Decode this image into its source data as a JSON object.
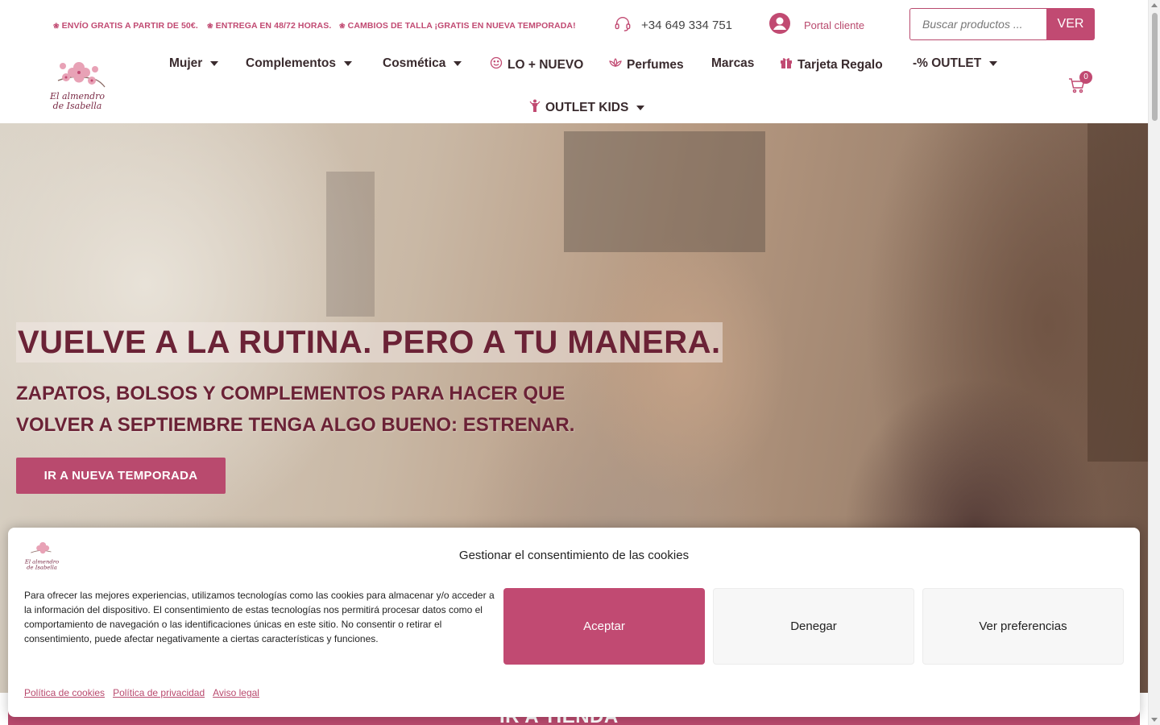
{
  "topbar": {
    "promos": [
      "ENVÍO GRATIS A PARTIR DE 50€.",
      "ENTREGA EN 48/72 HORAS.",
      "CAMBIOS DE TALLA ¡GRATIS EN NUEVA TEMPORADA!"
    ],
    "phone": "+34 649 334 751",
    "portal_label": "Portal cliente",
    "search_placeholder": "Buscar productos ...",
    "search_button": "VER"
  },
  "logo": {
    "line1": "El almendro",
    "line2": "de Isabella"
  },
  "nav": {
    "items": [
      {
        "label": "Mujer",
        "icon": "",
        "dropdown": true
      },
      {
        "label": "Complementos",
        "icon": "",
        "dropdown": true
      },
      {
        "label": "Cosmética",
        "icon": "",
        "dropdown": true
      },
      {
        "label": "LO + NUEVO",
        "icon": "smile-icon",
        "dropdown": false
      },
      {
        "label": "Perfumes",
        "icon": "lotus-icon",
        "dropdown": false
      },
      {
        "label": "Marcas",
        "icon": "",
        "dropdown": false
      },
      {
        "label": "Tarjeta Regalo",
        "icon": "gift-icon",
        "dropdown": false
      },
      {
        "label": "-% OUTLET",
        "icon": "",
        "dropdown": true
      },
      {
        "label": "OUTLET KIDS",
        "icon": "child-icon",
        "dropdown": true
      }
    ],
    "cart_count": "0"
  },
  "hero": {
    "title": "VUELVE A LA RUTINA. PERO A TU MANERA.",
    "subtitle_line1": "ZAPATOS, BOLSOS Y COMPLEMENTOS PARA HACER QUE",
    "subtitle_line2": "VOLVER A SEPTIEMBRE TENGA ALGO BUENO: ESTRENAR.",
    "button": "IR A NUEVA TEMPORADA"
  },
  "below": {
    "text": "IR A TIENDA"
  },
  "cookie": {
    "title": "Gestionar el consentimiento de las cookies",
    "text": "Para ofrecer las mejores experiencias, utilizamos tecnologías como las cookies para almacenar y/o acceder a la información del dispositivo. El consentimiento de estas tecnologías nos permitirá procesar datos como el comportamiento de navegación o las identificaciones únicas en este sitio. No consentir o retirar el consentimiento, puede afectar negativamente a ciertas características y funciones.",
    "accept": "Aceptar",
    "deny": "Denegar",
    "prefs": "Ver preferencias",
    "links": [
      "Política de cookies",
      "Política de privacidad",
      "Aviso legal"
    ]
  },
  "colors": {
    "brand": "#c14a72",
    "heading": "#6b2236",
    "nav_text": "#3a2b2e"
  }
}
